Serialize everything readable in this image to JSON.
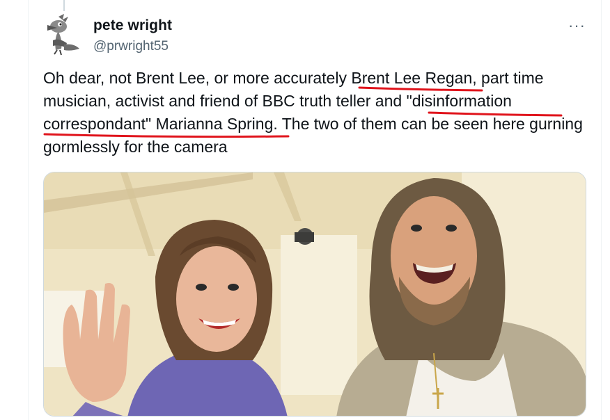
{
  "author": {
    "display_name": "pete wright",
    "handle": "@prwright55"
  },
  "tweet": {
    "part1": "Oh dear, not Brent Lee, or more accurately ",
    "highlight1": "Brent Lee Regan",
    "part2": ", part time musician, activist and friend of BBC truth teller and ",
    "highlight2": "\"disinformation correspondant\" Marianna Spring",
    "part3": ". The two of them can be seen here gurning gormlessly for the camera"
  },
  "more_label": "···",
  "icons": {
    "avatar": "road-runner-avatar-icon",
    "more": "more-options-icon"
  },
  "colors": {
    "underline": "#e0141c",
    "secondary_text": "#536471",
    "photo_bg": "#f1e8cc"
  }
}
